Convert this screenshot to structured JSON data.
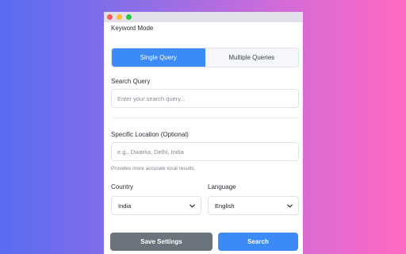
{
  "window": {
    "controls": [
      {
        "name": "close",
        "color": "#ff5f57"
      },
      {
        "name": "minimize",
        "color": "#febc2e"
      },
      {
        "name": "maximize",
        "color": "#28c840"
      }
    ]
  },
  "keyword_mode": {
    "label": "Keyword Mode",
    "options": [
      "Single Query",
      "Multiple Queries"
    ],
    "selected": "Single Query"
  },
  "search_query": {
    "label": "Search Query",
    "placeholder": "Enter your search query...",
    "value": ""
  },
  "location": {
    "label": "Specific Location (Optional)",
    "placeholder": "e.g., Dwarka, Delhi, India",
    "value": "",
    "hint": "Provides more accurate local results."
  },
  "country": {
    "label": "Country",
    "selected": "India"
  },
  "language": {
    "label": "Language",
    "selected": "English"
  },
  "buttons": {
    "save_label": "Save Settings",
    "search_label": "Search"
  },
  "colors": {
    "accent": "#3b8af5",
    "secondary_button": "#6b737d"
  },
  "icons": {
    "select_arrow": "chevron-down-icon"
  }
}
